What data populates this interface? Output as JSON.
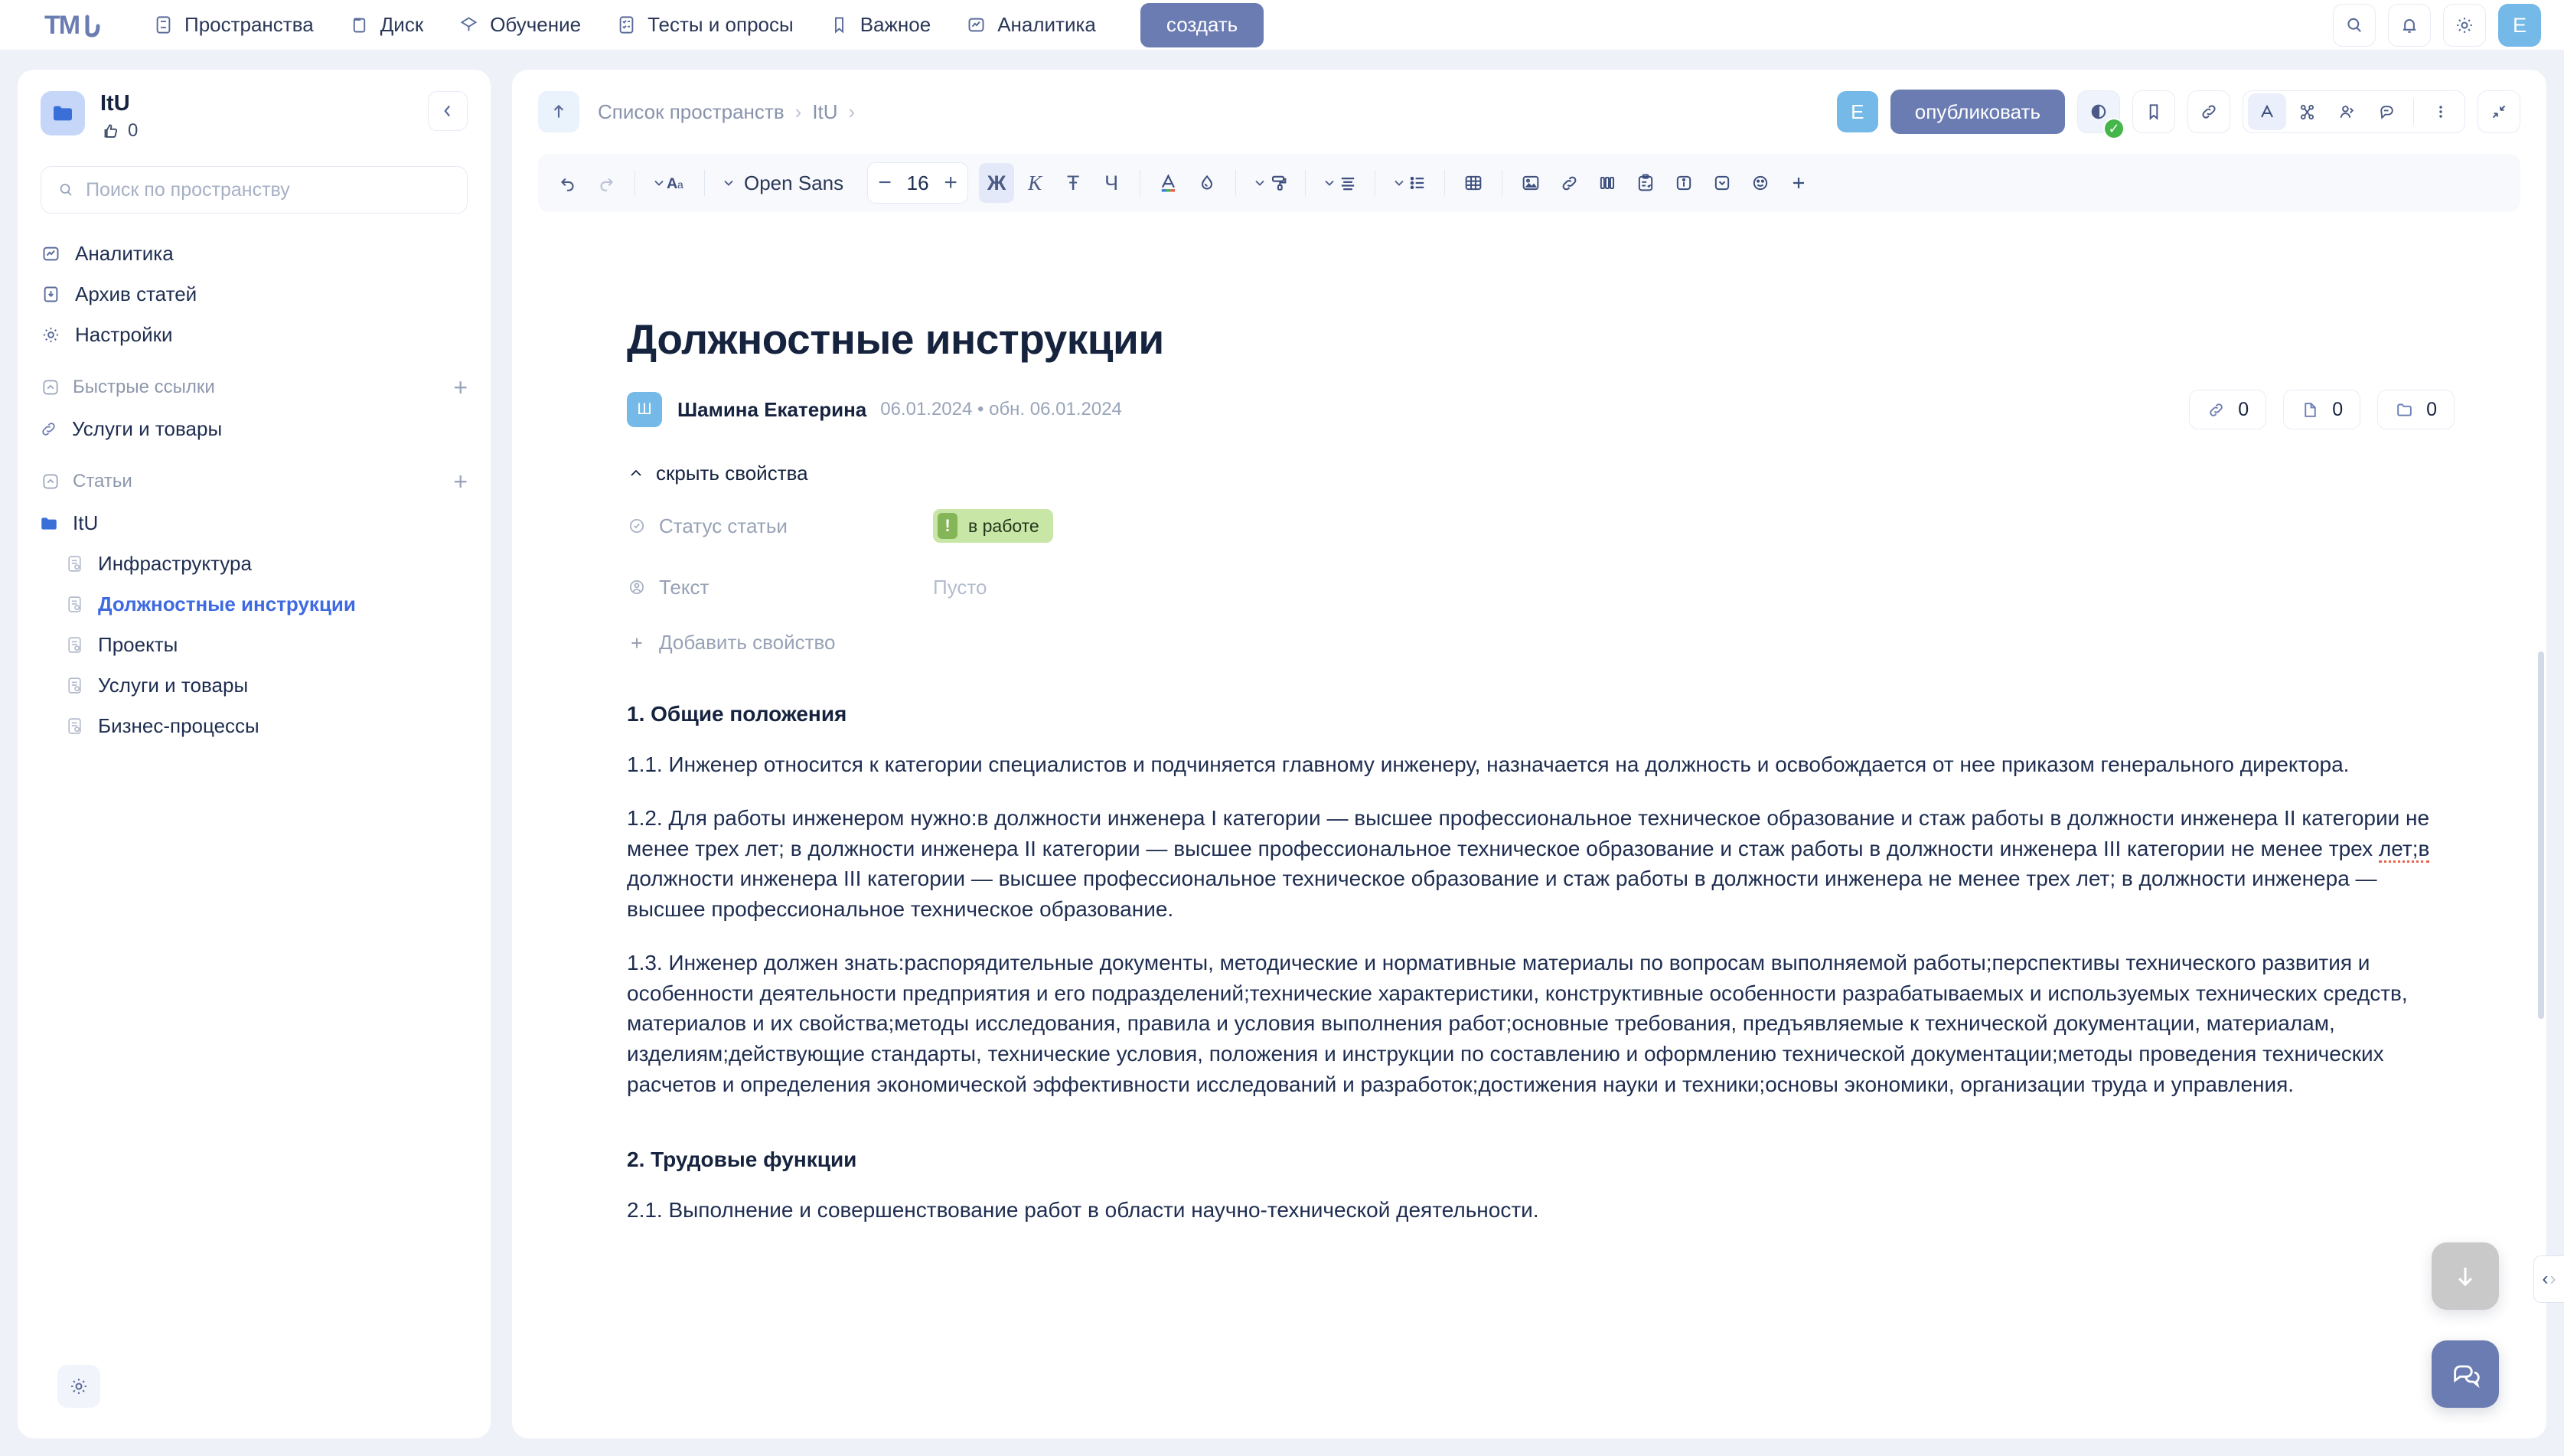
{
  "topnav": {
    "logo_text": "TML",
    "items": [
      {
        "label": "Пространства",
        "icon": "spaces-icon"
      },
      {
        "label": "Диск",
        "icon": "drive-icon"
      },
      {
        "label": "Обучение",
        "icon": "graduation-icon"
      },
      {
        "label": "Тесты и опросы",
        "icon": "checklist-icon"
      },
      {
        "label": "Важное",
        "icon": "bookmark-icon"
      },
      {
        "label": "Аналитика",
        "icon": "analytics-icon"
      }
    ],
    "create_label": "создать",
    "search_icon": "search-icon",
    "bell_icon": "bell-icon",
    "gear_icon": "gear-icon",
    "avatar_initial": "E"
  },
  "sidebar": {
    "space_name": "ItU",
    "likes_count": "0",
    "search_placeholder": "Поиск по пространству",
    "search_value": "",
    "nav": [
      {
        "label": "Аналитика",
        "icon": "analytics-icon"
      },
      {
        "label": "Архив статей",
        "icon": "archive-icon"
      },
      {
        "label": "Настройки",
        "icon": "gear-icon"
      }
    ],
    "quick_links": {
      "title": "Быстрые ссылки",
      "add_label": "+",
      "items": [
        {
          "label": "Услуги и товары",
          "icon": "link-icon"
        }
      ]
    },
    "articles": {
      "title": "Статьи",
      "add_label": "+",
      "folder": {
        "label": "ItU",
        "icon": "folder-icon"
      },
      "items": [
        {
          "label": "Инфраструктура",
          "icon": "article-icon",
          "active": false
        },
        {
          "label": "Должностные инструкции",
          "icon": "article-icon",
          "active": true
        },
        {
          "label": "Проекты",
          "icon": "article-icon",
          "active": false
        },
        {
          "label": "Услуги и товары",
          "icon": "article-icon",
          "active": false
        },
        {
          "label": "Бизнес-процессы",
          "icon": "article-icon",
          "active": false
        }
      ]
    },
    "settings_icon": "gear-icon"
  },
  "docheader": {
    "back_icon": "arrow-up-icon",
    "breadcrumbs": [
      "Список пространств",
      "ItU"
    ],
    "separator": "›",
    "avatar_initial": "E",
    "publish_label": "опубликовать",
    "preview_icon": "eye-icon",
    "preview_badge": "✓",
    "bookmark_icon": "bookmark-icon",
    "link_icon": "link-icon",
    "text_icon": "font-A-icon",
    "scissors_icon": "scissors-icon",
    "members_icon": "members-icon",
    "comment_icon": "comment-icon",
    "more_icon": "more-vertical-icon",
    "collapse_icon": "collapse-icon"
  },
  "toolbar": {
    "undo_icon": "undo-icon",
    "redo_icon": "redo-icon",
    "style_icon": "text-style-Aa-icon",
    "font_name": "Open Sans",
    "font_size": "16",
    "minus": "−",
    "plus": "+",
    "bold_label": "Ж",
    "italic_label": "К",
    "strike_label": "Ŧ",
    "underline_label": "Ч",
    "color_icon": "text-color-icon",
    "highlight_icon": "drop-icon",
    "paint_icon": "paint-roller-icon",
    "align_icon": "align-icon",
    "list_icon": "bullet-list-icon",
    "table_icon": "table-icon",
    "image_icon": "image-icon",
    "link_icon": "link-icon",
    "columns_icon": "columns-icon",
    "task_icon": "clipboard-icon",
    "info_icon": "info-icon",
    "details_icon": "details-icon",
    "emoji_icon": "emoji-icon",
    "add_icon": "plus-icon"
  },
  "document": {
    "title": "Должностные инструкции",
    "author_initial": "Ш",
    "author": "Шамина Екатерина",
    "dates": "06.01.2024 • обн. 06.01.2024",
    "counters": [
      {
        "icon": "link-icon",
        "value": "0"
      },
      {
        "icon": "file-icon",
        "value": "0"
      },
      {
        "icon": "folder-icon",
        "value": "0"
      }
    ],
    "props_toggle": "скрыть свойства",
    "props": [
      {
        "icon": "check-circle-icon",
        "key": "Статус статьи",
        "type": "chip",
        "chip_mark": "!",
        "chip_text": "в работе"
      },
      {
        "icon": "user-circle-icon",
        "key": "Текст",
        "type": "text",
        "value": "Пусто"
      }
    ],
    "add_prop": "Добавить свойство",
    "blocks": [
      {
        "type": "h",
        "text": "1. Общие положения"
      },
      {
        "type": "p",
        "text": "1.1. Инженер относится к категории специалистов и подчиняется главному инженеру, назначается на должность и освобождается от нее приказом генерального директора."
      },
      {
        "type": "p",
        "text": "1.2. Для работы инженером нужно:в должности инженера I категории — высшее профессиональное техническое образование и стаж работы в должности инженера II категории не менее трех лет; в должности инженера II категории — высшее профессиональное техническое образование и стаж работы в должности инженера III категории не менее трех лет;в должности инженера III категории — высшее профессиональное техническое образование и стаж работы в должности инженера не менее трех лет; в должности инженера — высшее профессиональное техническое образование."
      },
      {
        "type": "p",
        "text": "1.3. Инженер должен знать:распорядительные документы, методические и нормативные материалы по вопросам выполняемой работы;перспективы технического развития и особенности деятельности предприятия и его подразделений;технические характеристики, конструктивные особенности разрабатываемых и используемых технических средств, материалов и их свойства;методы исследования, правила и условия выполнения работ;основные требования, предъявляемые к технической документации, материалам, изделиям;действующие стандарты, технические условия, положения и инструкции по составлению и оформлению технической документации;методы проведения технических расчетов и определения экономической эффективности исследований и разработок;достижения науки и техники;основы экономики, организации труда и управления."
      },
      {
        "type": "h",
        "text": "2. Трудовые функции"
      },
      {
        "type": "p",
        "text": "2.1. Выполнение и совершенствование работ в области научно-технической деятельности."
      }
    ]
  },
  "floating": {
    "scroll_down_icon": "arrow-down-icon",
    "chat_icon": "chat-bubbles-icon",
    "panel_toggle_left": "‹",
    "panel_toggle_right": "›"
  },
  "colors": {
    "accent": "#6b7cb3",
    "link": "#3e6ae1",
    "avatar": "#74b9e7",
    "status_chip_bg": "#c8e6a6",
    "status_mark": "#84b556",
    "text": "#1e2d50"
  }
}
